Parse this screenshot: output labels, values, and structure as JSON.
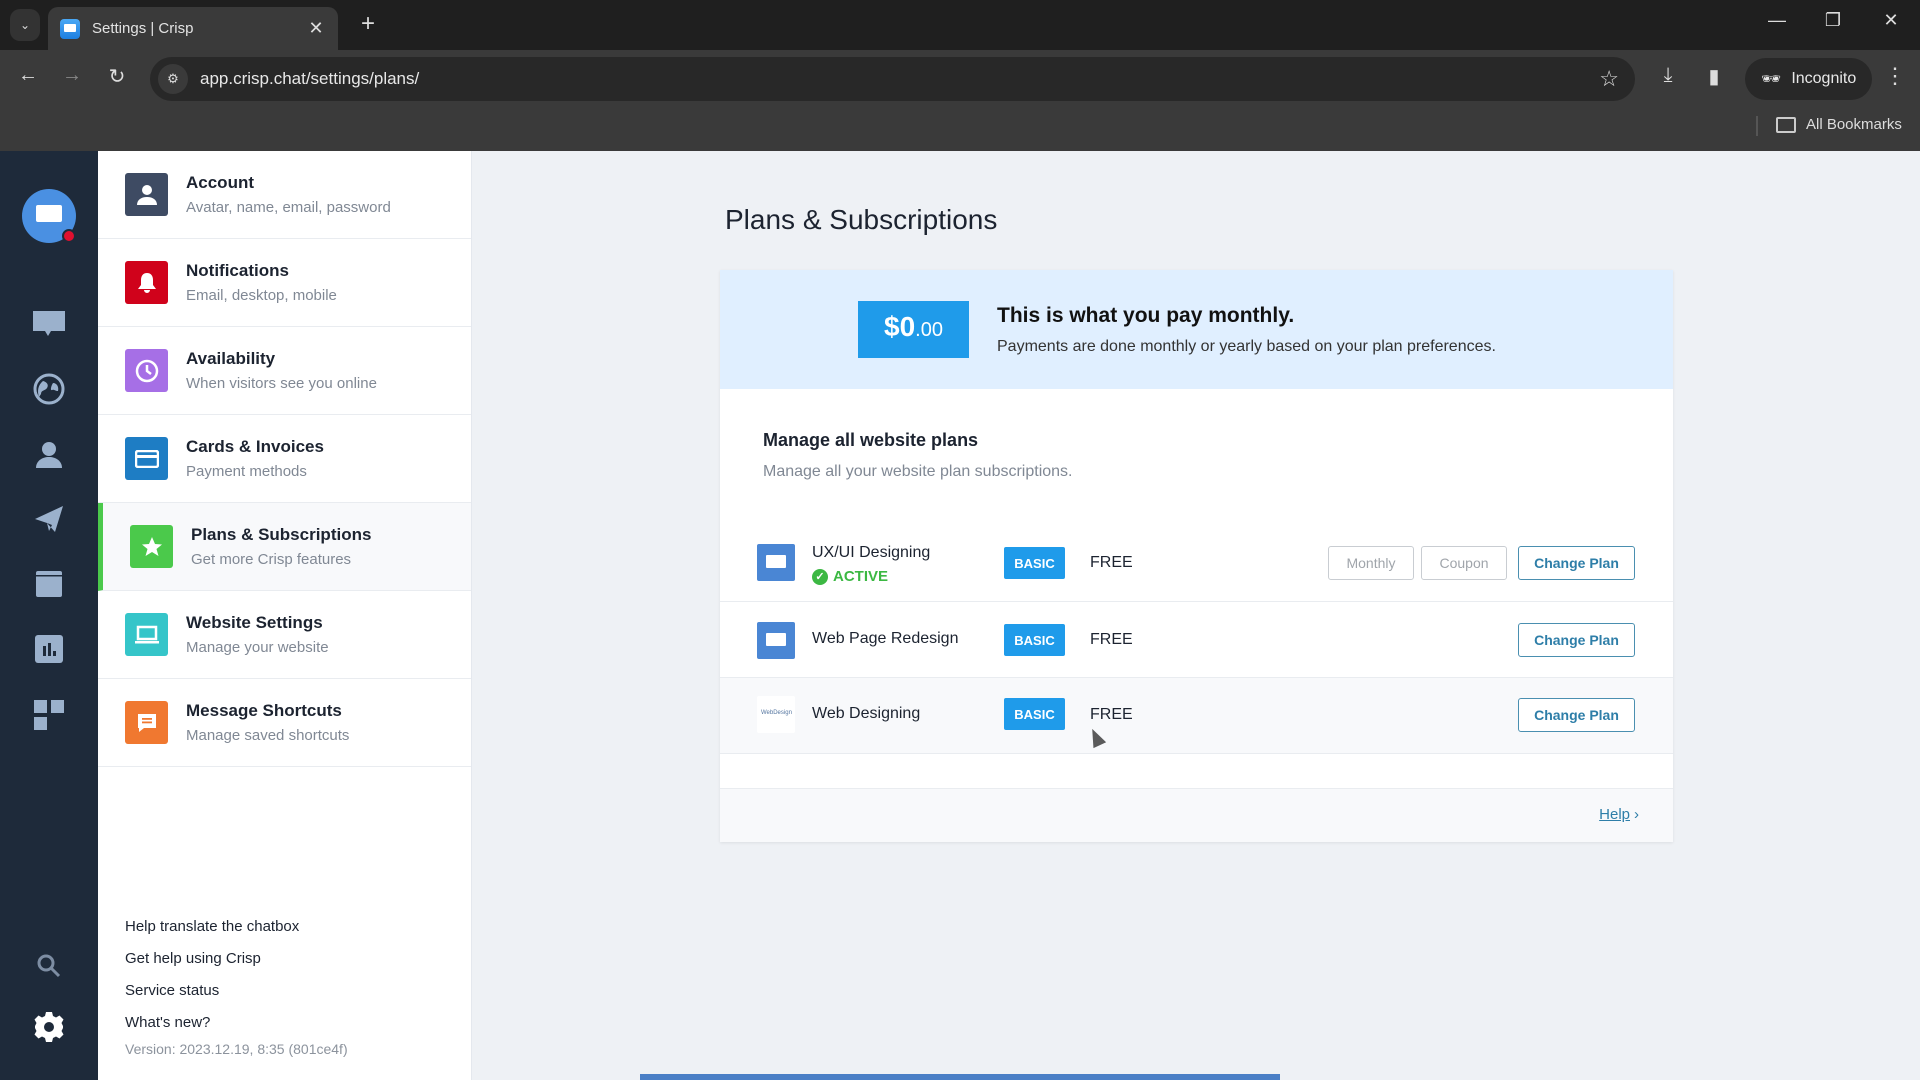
{
  "browser": {
    "tab_title": "Settings | Crisp",
    "url": "app.crisp.chat/settings/plans/",
    "incognito_label": "Incognito",
    "bookmarks_label": "All Bookmarks"
  },
  "rail": {
    "items": [
      "conversations",
      "visitors",
      "contacts",
      "campaigns",
      "helpdesk",
      "analytics",
      "plugins"
    ],
    "bottom": [
      "search",
      "settings"
    ]
  },
  "sidebar": {
    "items": [
      {
        "title": "Account",
        "subtitle": "Avatar, name, email, password",
        "color": "#3e4b63",
        "icon": "user-icon"
      },
      {
        "title": "Notifications",
        "subtitle": "Email, desktop, mobile",
        "color": "#d0021b",
        "icon": "bell-icon"
      },
      {
        "title": "Availability",
        "subtitle": "When visitors see you online",
        "color": "#a66fe6",
        "icon": "clock-icon"
      },
      {
        "title": "Cards & Invoices",
        "subtitle": "Payment methods",
        "color": "#1e7dc4",
        "icon": "card-icon"
      },
      {
        "title": "Plans & Subscriptions",
        "subtitle": "Get more Crisp features",
        "color": "#4bc94b",
        "icon": "star-icon",
        "active": true
      },
      {
        "title": "Website Settings",
        "subtitle": "Manage your website",
        "color": "#35c5c9",
        "icon": "laptop-icon"
      },
      {
        "title": "Message Shortcuts",
        "subtitle": "Manage saved shortcuts",
        "color": "#f07830",
        "icon": "message-icon"
      }
    ],
    "links": [
      "Help translate the chatbox",
      "Get help using Crisp",
      "Service status",
      "What's new?"
    ],
    "version": "Version: 2023.12.19, 8:35 (801ce4f)"
  },
  "main": {
    "title": "Plans & Subscriptions",
    "billing": {
      "amount_main": "$0",
      "amount_cents": ".00",
      "headline": "This is what you pay monthly.",
      "subtext": "Payments are done monthly or yearly based on your plan preferences."
    },
    "section": {
      "title": "Manage all website plans",
      "subtitle": "Manage all your website plan subscriptions."
    },
    "plans": [
      {
        "name": "UX/UI Designing",
        "status": "ACTIVE",
        "badge": "BASIC",
        "price": "FREE",
        "buttons": [
          "Monthly",
          "Coupon",
          "Change Plan"
        ]
      },
      {
        "name": "Web Page Redesign",
        "badge": "BASIC",
        "price": "FREE",
        "buttons": [
          "Change Plan"
        ]
      },
      {
        "name": "Web Designing",
        "badge": "BASIC",
        "price": "FREE",
        "buttons": [
          "Change Plan"
        ],
        "logo_text": "WebDesign"
      }
    ],
    "help_label": "Help"
  }
}
